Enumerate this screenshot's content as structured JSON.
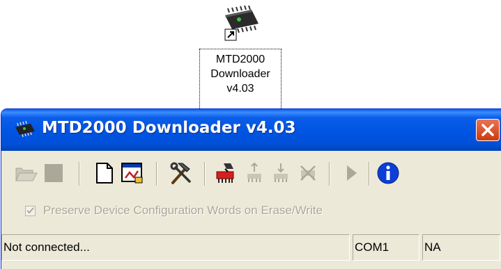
{
  "desktop": {
    "shortcut": {
      "icon": "chip-shortcut-icon",
      "label_lines": [
        "MTD2000",
        "Downloader",
        "v4.03"
      ]
    }
  },
  "window": {
    "title": "MTD2000 Downloader v4.03",
    "title_icon": "chip-icon",
    "close_icon": "close-icon",
    "toolbar": [
      {
        "name": "open-icon",
        "enabled": false
      },
      {
        "name": "save-icon",
        "enabled": false
      },
      {
        "name": "new-file-icon",
        "enabled": true
      },
      {
        "name": "window-edit-icon",
        "enabled": true
      },
      {
        "name": "tools-icon",
        "enabled": true
      },
      {
        "name": "chip-program-icon",
        "enabled": true
      },
      {
        "name": "chip-upload-icon",
        "enabled": false
      },
      {
        "name": "chip-download-icon",
        "enabled": false
      },
      {
        "name": "chip-erase-icon",
        "enabled": false
      },
      {
        "name": "run-icon",
        "enabled": false
      },
      {
        "name": "info-icon",
        "enabled": true
      }
    ],
    "checkbox": {
      "label": "Preserve Device Configuration Words on Erase/Write",
      "checked": true,
      "enabled": false
    },
    "status": {
      "connection": "Not connected...",
      "port": "COM1",
      "device": "NA"
    }
  }
}
